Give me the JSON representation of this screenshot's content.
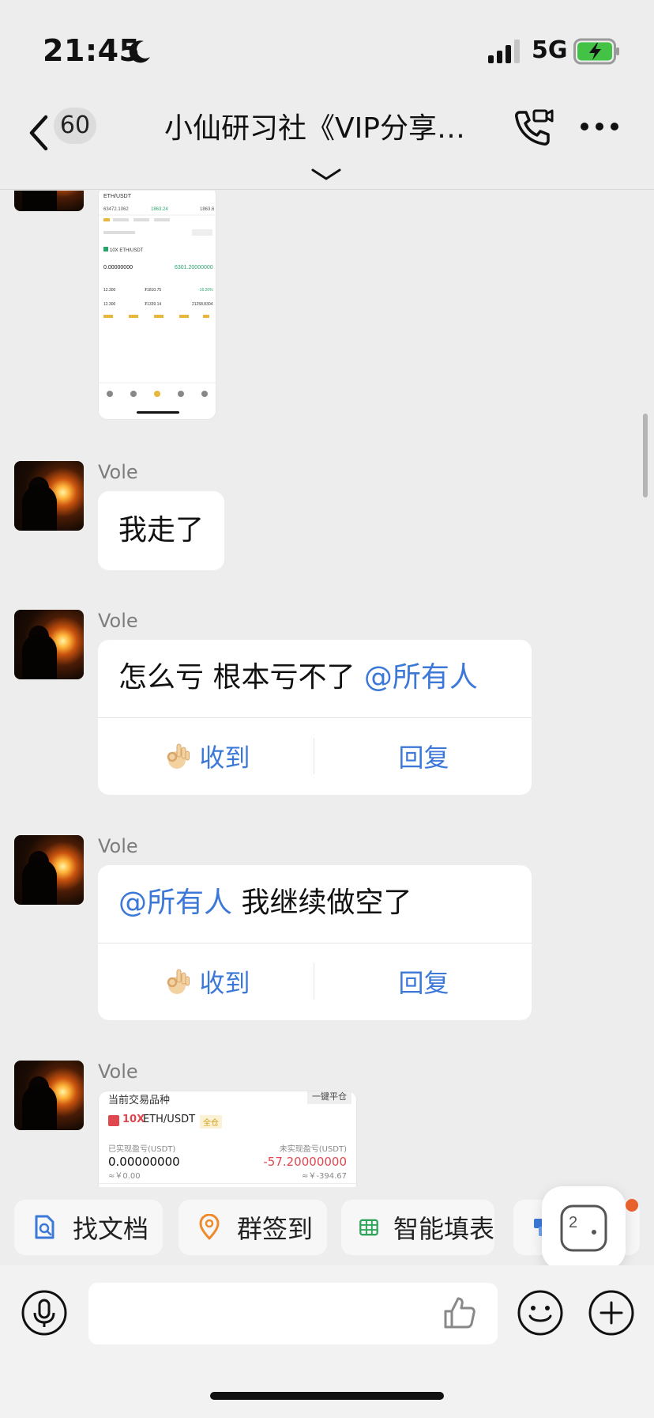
{
  "status": {
    "time": "21:45",
    "network": "5G"
  },
  "nav": {
    "unread_count": "60",
    "title": "小仙研习社《VIP分享…"
  },
  "messages": [
    {
      "type": "image"
    },
    {
      "type": "text",
      "sender": "Vole",
      "text": "我走了"
    },
    {
      "type": "notice",
      "sender": "Vole",
      "text": "怎么亏 根本亏不了",
      "mention": "@所有人",
      "ack_label": "收到",
      "reply_label": "回复"
    },
    {
      "type": "notice",
      "sender": "Vole",
      "mention": "@所有人",
      "text": "我继续做空了",
      "ack_label": "收到",
      "reply_label": "回复"
    },
    {
      "type": "image",
      "sender": "Vole"
    }
  ],
  "img1": {
    "pair": "ETH/USDT",
    "v1": "63472.1062",
    "v2": "1863.24",
    "v3": "1863.6",
    "pos": "10X ETH/USDT",
    "p1": "0.00000000",
    "p2": "6301.20000000",
    "p3": "12.300",
    "p4": "₮1810.75",
    "p5": "-16.20%",
    "p6": "12.300",
    "p7": "₮1339.14",
    "p8": "21258.8304"
  },
  "img2": {
    "header": "当前交易品种",
    "close_all": "一键平仓",
    "leverage": "10X",
    "pair": "ETH/USDT",
    "margin_mode": "全仓",
    "realized_label": "已实现盈亏(USDT)",
    "realized_value": "0.00000000",
    "realized_cny": "≈￥0.00",
    "unrealized_label": "未实现盈亏(USDT)",
    "unrealized_value": "-57.20000000",
    "unrealized_cny": "≈￥-394.67"
  },
  "tools": [
    {
      "label": "找文档",
      "icon": "doc-search-icon"
    },
    {
      "label": "群签到",
      "icon": "location-pin-icon"
    },
    {
      "label": "智能填表",
      "icon": "table-icon"
    }
  ],
  "float_badge": "2",
  "colors": {
    "mention": "#3b78d8",
    "background": "#ededed",
    "bubble": "#ffffff",
    "accent_red": "#e8612c"
  }
}
